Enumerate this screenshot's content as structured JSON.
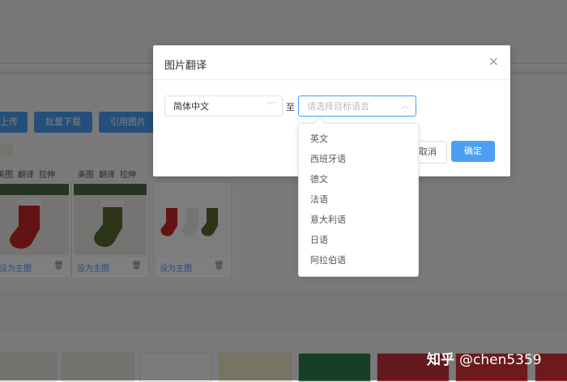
{
  "toolbar": {
    "upload_label": "上传",
    "batch_download_label": "批量下载",
    "cite_image_label": "引用图片"
  },
  "cards": [
    {
      "actions": [
        "美图",
        "翻译",
        "拉伸"
      ],
      "set_main_label": "设为主图"
    },
    {
      "actions": [
        "美图",
        "翻译",
        "拉伸"
      ],
      "set_main_label": "设为主图"
    },
    {
      "set_main_label": "设为主图"
    }
  ],
  "dialog": {
    "title": "图片翻译",
    "close_icon": "close-icon",
    "source_language": "简体中文",
    "to_label": "至",
    "target_placeholder": "请选择目标语言",
    "cancel_label": "取消",
    "confirm_label": "确定"
  },
  "dropdown": {
    "options": [
      "英文",
      "西班牙语",
      "德文",
      "法语",
      "意大利语",
      "日语",
      "阿拉伯语"
    ]
  },
  "watermark": {
    "logo": "知乎",
    "author": "@chen5359"
  },
  "colors": {
    "accent": "#4a9ff5",
    "focus_border": "#409eff",
    "overlay": "rgba(0,0,0,0.5)"
  }
}
